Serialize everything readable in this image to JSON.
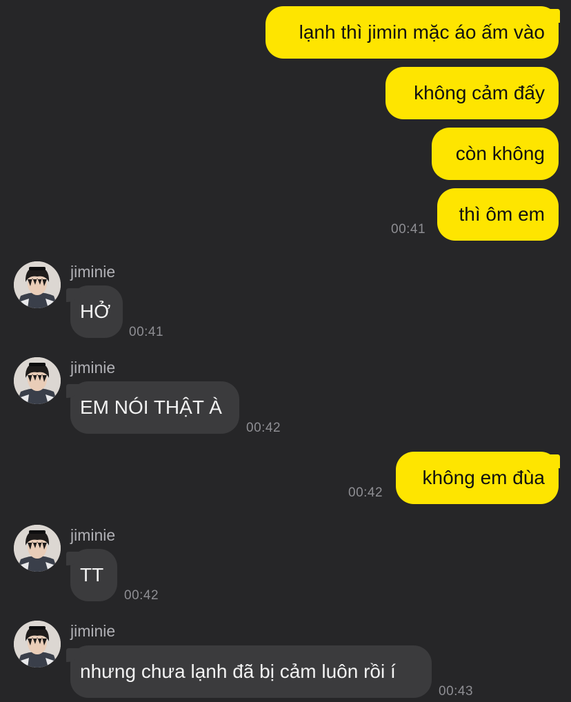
{
  "contact": {
    "name": "jiminie"
  },
  "messages": [
    {
      "direction": "out",
      "text": "lạnh thì jimin mặc áo ấm vào",
      "time": ""
    },
    {
      "direction": "out",
      "text": "không cảm đấy",
      "time": ""
    },
    {
      "direction": "out",
      "text": "còn không",
      "time": ""
    },
    {
      "direction": "out",
      "text": "thì ôm em",
      "time": "00:41"
    },
    {
      "direction": "in",
      "sender": "jiminie",
      "text": "HỞ",
      "time": "00:41"
    },
    {
      "direction": "in",
      "sender": "jiminie",
      "text": "EM NÓI THẬT À",
      "time": "00:42"
    },
    {
      "direction": "out",
      "text": "không em đùa",
      "time": "00:42"
    },
    {
      "direction": "in",
      "sender": "jiminie",
      "text": "TT",
      "time": "00:42"
    },
    {
      "direction": "in",
      "sender": "jiminie",
      "text": "nhưng chưa lạnh đã bị cảm luôn rồi í",
      "time": "00:43"
    }
  ],
  "colors": {
    "background": "#262628",
    "outgoing_bubble": "#FEE500",
    "incoming_bubble": "#3B3B3D",
    "timestamp": "#8E8E93"
  },
  "icons": {
    "avatar": "profile-photo-avatar"
  }
}
